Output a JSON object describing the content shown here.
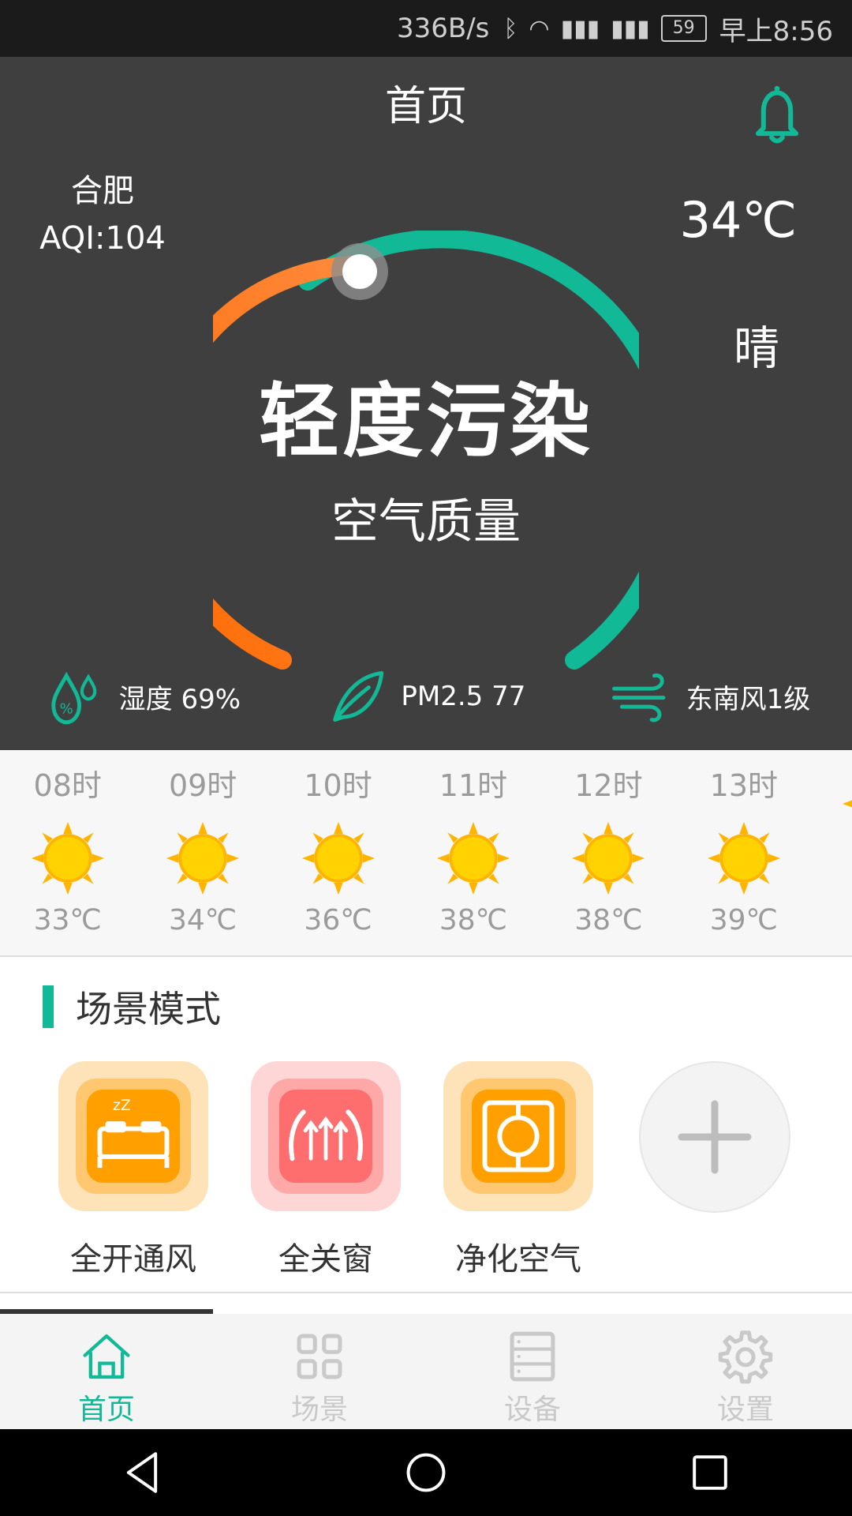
{
  "status_bar": {
    "net_speed": "336B/s",
    "battery": "59",
    "time": "早上8:56"
  },
  "header": {
    "title": "首页"
  },
  "hero": {
    "city": "合肥",
    "aqi": "AQI:104",
    "temperature": "34℃",
    "weather": "晴",
    "pollution_level": "轻度污染",
    "air_quality_label": "空气质量",
    "colors": {
      "accent": "#12b996",
      "warning": "#ff6a00",
      "bg": "#3f3f3f"
    }
  },
  "stats": {
    "humidity": "湿度 69%",
    "pm25": "PM2.5 77",
    "wind": "东南风1级"
  },
  "hourly": [
    {
      "time": "08时",
      "temp": "33℃"
    },
    {
      "time": "09时",
      "temp": "34℃"
    },
    {
      "time": "10时",
      "temp": "36℃"
    },
    {
      "time": "11时",
      "temp": "38℃"
    },
    {
      "time": "12时",
      "temp": "38℃"
    },
    {
      "time": "13时",
      "temp": "39℃"
    }
  ],
  "scene": {
    "title": "场景模式",
    "items": [
      {
        "label": "全开通风",
        "icon": "bed-icon"
      },
      {
        "label": "全关窗",
        "icon": "heat-flow-icon"
      },
      {
        "label": "净化空气",
        "icon": "purifier-icon"
      }
    ],
    "add_icon": "plus-icon"
  },
  "nav": {
    "items": [
      {
        "label": "首页",
        "icon": "home-icon"
      },
      {
        "label": "场景",
        "icon": "grid-icon"
      },
      {
        "label": "设备",
        "icon": "device-icon"
      },
      {
        "label": "设置",
        "icon": "gear-icon"
      }
    ]
  }
}
